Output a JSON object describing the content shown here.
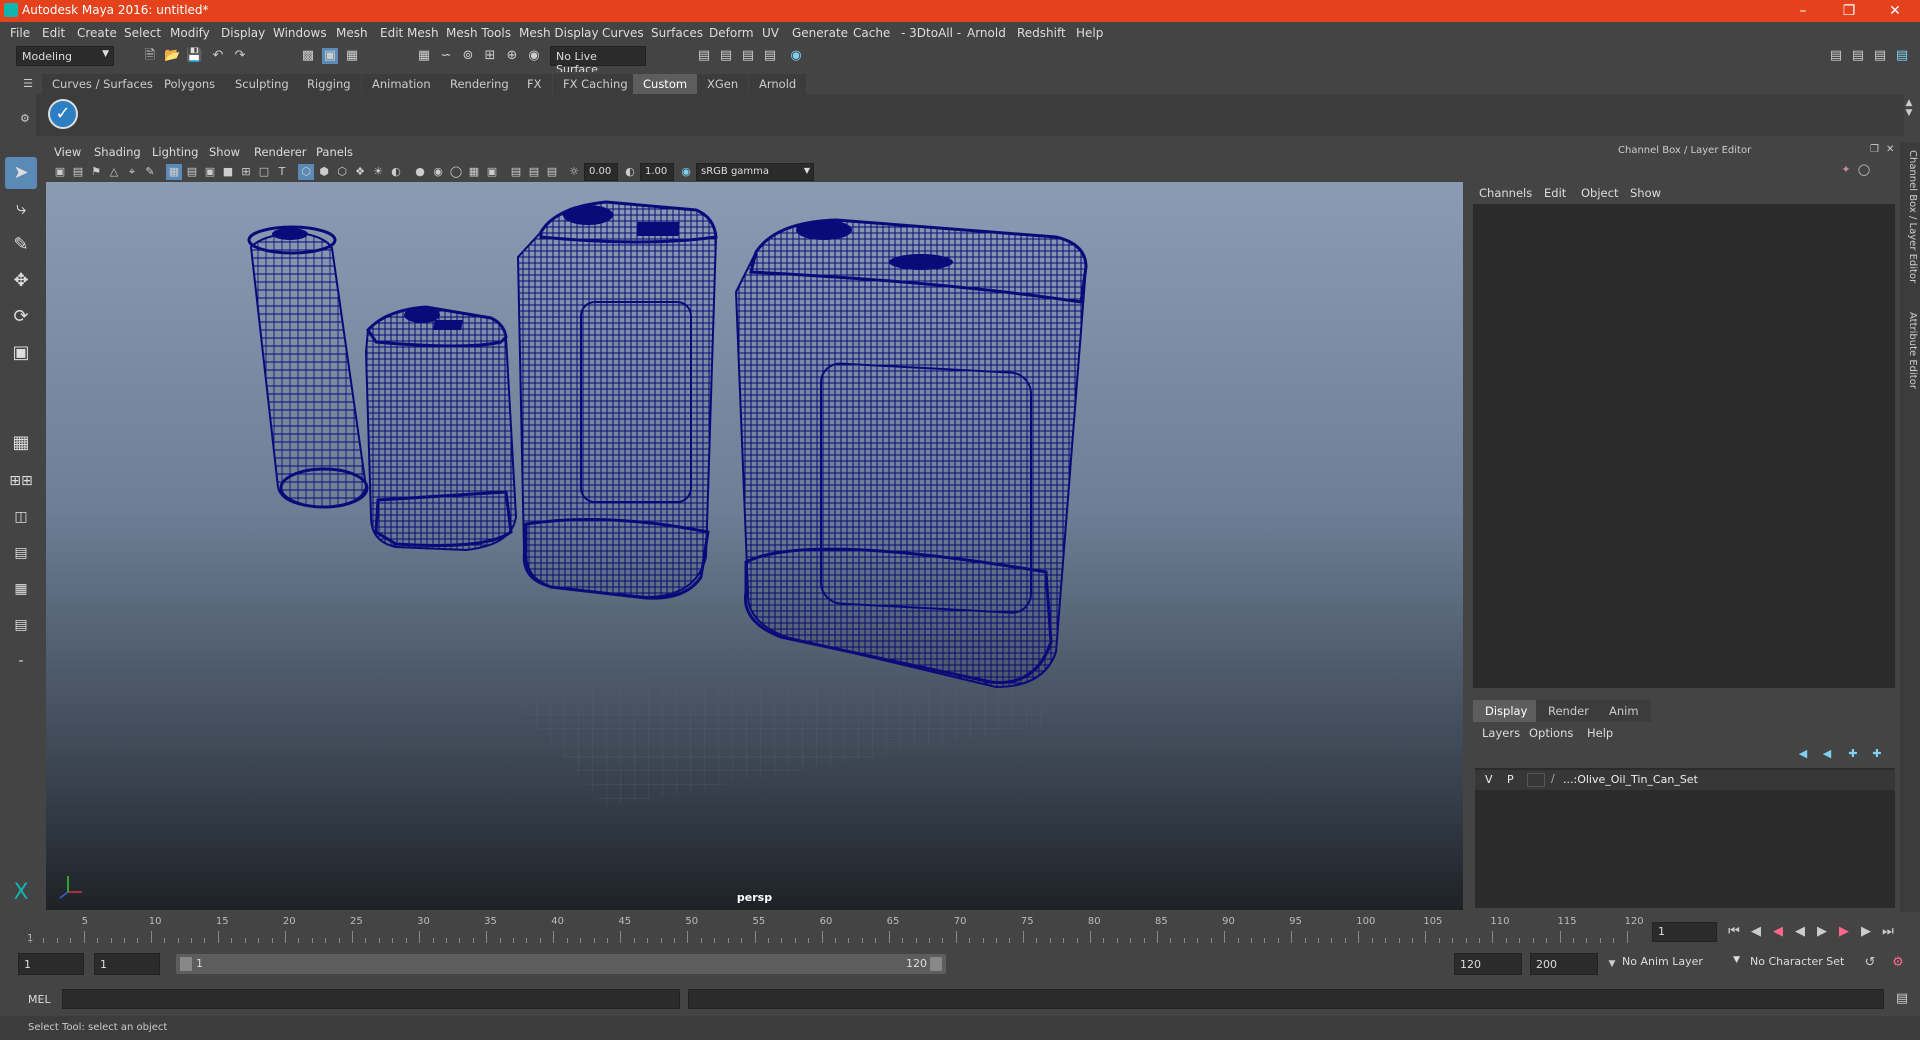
{
  "window": {
    "title": "Autodesk Maya 2016: untitled*"
  },
  "menubar": [
    "File",
    "Edit",
    "Create",
    "Select",
    "Modify",
    "Display",
    "Windows",
    "Mesh",
    "Edit Mesh",
    "Mesh Tools",
    "Mesh Display",
    "Curves",
    "Surfaces",
    "Deform",
    "UV",
    "Generate",
    "Cache",
    "- 3DtoAll -",
    "Arnold",
    "Redshift",
    "Help"
  ],
  "statusline": {
    "mode": "Modeling",
    "live_surface": "No Live Surface"
  },
  "shelf_tabs": [
    "Curves / Surfaces",
    "Polygons",
    "Sculpting",
    "Rigging",
    "Animation",
    "Rendering",
    "FX",
    "FX Caching",
    "Custom",
    "XGen",
    "Arnold"
  ],
  "shelf_active": "Custom",
  "viewport": {
    "menu": [
      "View",
      "Shading",
      "Lighting",
      "Show",
      "Renderer",
      "Panels"
    ],
    "exposure": "0.00",
    "gamma": "1.00",
    "color_space": "sRGB gamma",
    "camera": "persp",
    "wire_color": "#0a0a7a"
  },
  "channel_box": {
    "title": "Channel Box / Layer Editor",
    "menu": [
      "Channels",
      "Edit",
      "Object",
      "Show"
    ],
    "side_tabs": [
      "Channel Box / Layer Editor",
      "Attribute Editor"
    ]
  },
  "layer_editor": {
    "tabs": [
      "Display",
      "Render",
      "Anim"
    ],
    "active_tab": "Display",
    "menu": [
      "Layers",
      "Options",
      "Help"
    ],
    "layers": [
      {
        "v": "V",
        "p": "P",
        "name": "...:Olive_Oil_Tin_Can_Set"
      }
    ]
  },
  "timeline": {
    "ticks": [
      "5",
      "10",
      "15",
      "20",
      "25",
      "30",
      "35",
      "40",
      "45",
      "50",
      "55",
      "60",
      "65",
      "70",
      "75",
      "80",
      "85",
      "90",
      "95",
      "100",
      "105",
      "110",
      "115",
      "120"
    ],
    "start_label": "1",
    "current_frame": "1"
  },
  "range": {
    "start": "1",
    "anim_start": "1",
    "slider_start": "1",
    "slider_end": "120",
    "anim_end": "120",
    "end": "200",
    "anim_layer": "No Anim Layer",
    "character_set": "No Character Set"
  },
  "command": {
    "label": "MEL"
  },
  "help": {
    "text": "Select Tool: select an object"
  }
}
